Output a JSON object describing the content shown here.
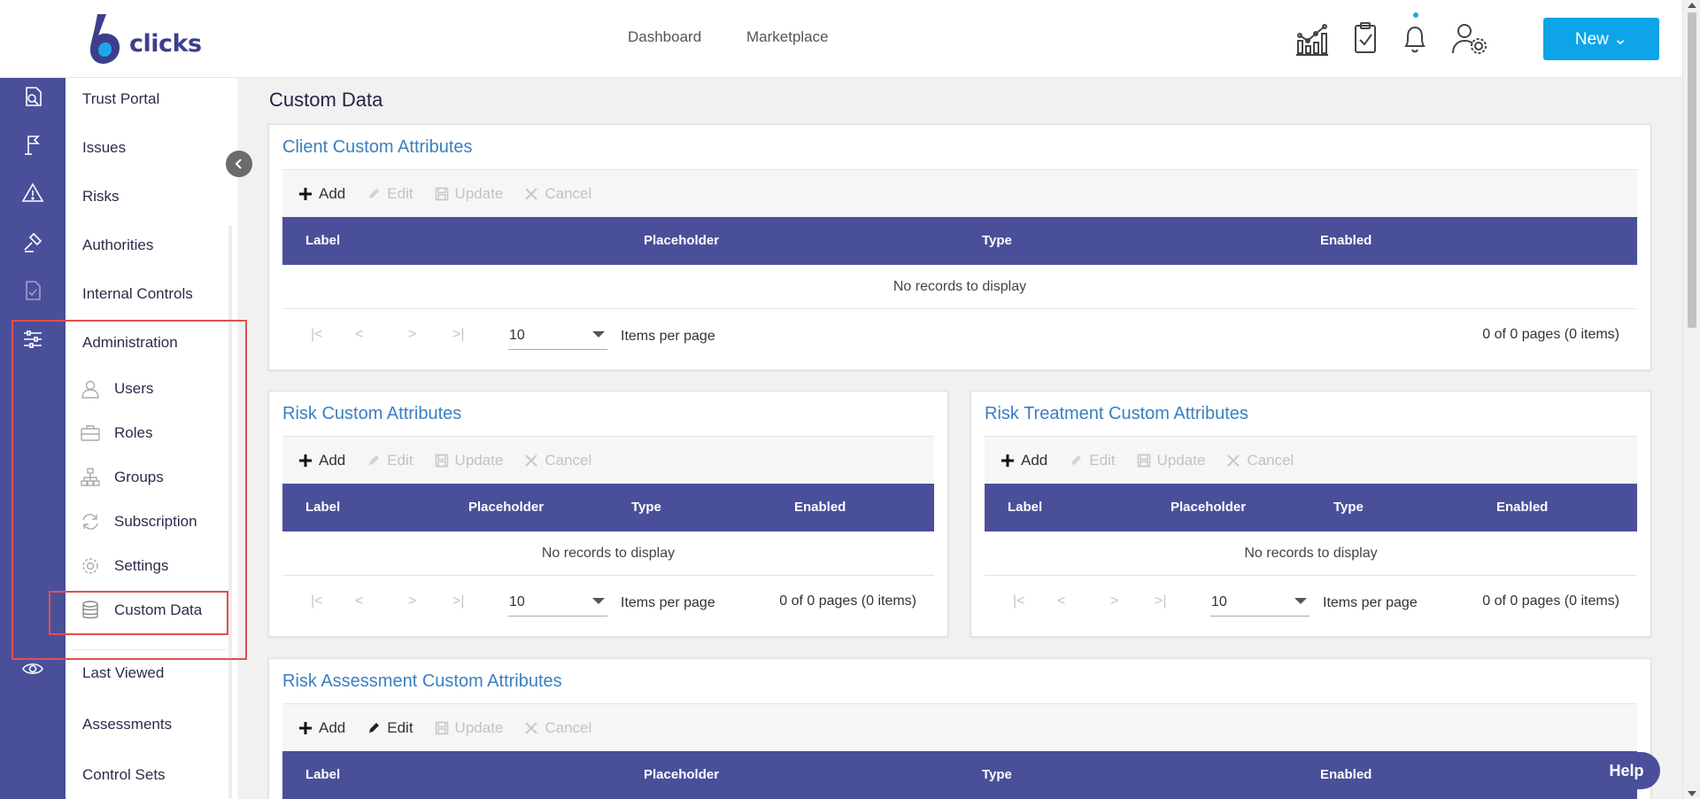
{
  "header": {
    "logo_text": "clicks",
    "nav": [
      "Dashboard",
      "Marketplace"
    ],
    "new_label": "New ⌄",
    "icons": [
      "analytics-icon",
      "clipboard-check-icon",
      "bell-icon",
      "user-settings-icon"
    ]
  },
  "sidebar": {
    "rail_icons": [
      "trust-portal-icon",
      "issues-icon",
      "risks-icon",
      "authorities-icon",
      "internal-controls-icon",
      "administration-icon",
      "last-viewed-icon"
    ],
    "items": [
      "Trust Portal",
      "Issues",
      "Risks",
      "Authorities",
      "Internal Controls",
      "Administration"
    ],
    "admin_sub": [
      {
        "label": "Users",
        "icon": "user-icon"
      },
      {
        "label": "Roles",
        "icon": "briefcase-icon"
      },
      {
        "label": "Groups",
        "icon": "hierarchy-icon"
      },
      {
        "label": "Subscription",
        "icon": "refresh-icon"
      },
      {
        "label": "Settings",
        "icon": "gear-icon"
      },
      {
        "label": "Custom Data",
        "icon": "database-icon"
      }
    ],
    "bottom_items": [
      "Last Viewed",
      "Assessments",
      "Control Sets"
    ]
  },
  "main": {
    "title": "Custom Data",
    "toolbar": {
      "add": "Add",
      "edit": "Edit",
      "update": "Update",
      "cancel": "Cancel"
    },
    "columns": [
      "Label",
      "Placeholder",
      "Type",
      "Enabled"
    ],
    "no_records": "No records to display",
    "page_size": "10",
    "items_per_page": "Items per page",
    "page_info": "0 of 0 pages (0 items)",
    "cards": [
      {
        "title": "Client Custom Attributes"
      },
      {
        "title": "Risk Custom Attributes"
      },
      {
        "title": "Risk Treatment Custom Attributes"
      },
      {
        "title": "Risk Assessment Custom Attributes"
      }
    ]
  },
  "help_label": "Help",
  "colors": {
    "primary": "#4a4f9a",
    "accent": "#0ea4e8",
    "link": "#3a7fc1"
  }
}
